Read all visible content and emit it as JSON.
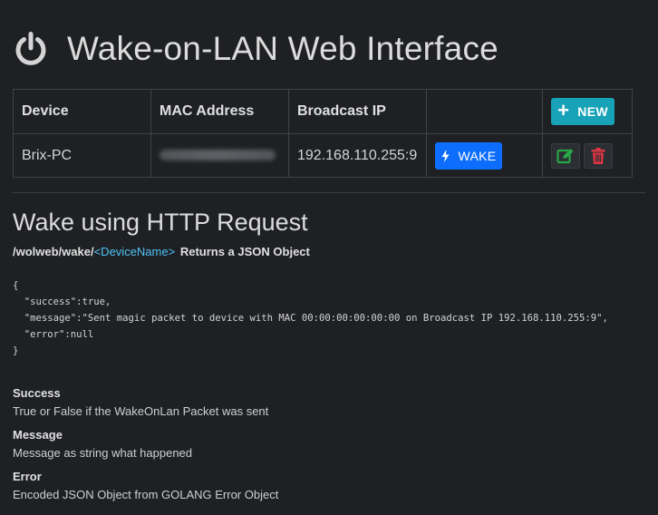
{
  "header": {
    "title": "Wake-on-LAN Web Interface",
    "icon": "power-icon"
  },
  "table": {
    "columns": [
      "Device",
      "MAC Address",
      "Broadcast IP",
      ""
    ],
    "new_button": "NEW",
    "rows": [
      {
        "device": "Brix-PC",
        "mac": "",
        "broadcast_ip": "192.168.110.255:9",
        "wake_button": "WAKE"
      }
    ]
  },
  "http": {
    "heading": "Wake using HTTP Request",
    "path": "/wolweb/wake/",
    "param": "<DeviceName>",
    "returns": "Returns a JSON Object",
    "json_lines": [
      "{",
      "  \"success\":true,",
      "  \"message\":\"Sent magic packet to device with MAC 00:00:00:00:00:00 on Broadcast IP 192.168.110.255:9\",",
      "  \"error\":null",
      "}"
    ]
  },
  "fields": [
    {
      "label": "Success",
      "text": "True or False if the WakeOnLan Packet was sent"
    },
    {
      "label": "Message",
      "text": "Message as string what happened"
    },
    {
      "label": "Error",
      "text": "Encoded JSON Object from GOLANG Error Object"
    }
  ],
  "colors": {
    "background": "#1e2023",
    "new_button": "#17a2b8",
    "wake_button": "#0d6efd",
    "edit": "#28a745",
    "delete": "#dc3545",
    "param": "#4fc3f7"
  }
}
